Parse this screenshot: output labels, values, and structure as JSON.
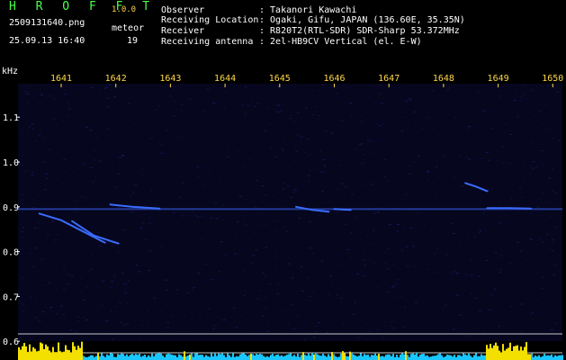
{
  "header": {
    "app_name": "H R O F F T",
    "version": "1.0.0",
    "filename": "2509131640.png",
    "datetime": "25.09.13 16:40",
    "meteor_label": "meteor",
    "meteor_count": "19"
  },
  "station": {
    "rows": [
      {
        "label": "Observer",
        "value": ": Takanori Kawachi"
      },
      {
        "label": "Receiving Location",
        "value": ": Ogaki, Gifu, JAPAN (136.60E, 35.35N)"
      },
      {
        "label": "Receiver",
        "value": ": R820T2(RTL-SDR) SDR-Sharp 53.372MHz"
      },
      {
        "label": "Receiving antenna",
        "value": ": 2el-HB9CV Vertical (el. E-W)"
      }
    ]
  },
  "chart_data": {
    "type": "heatmap",
    "ylabel": "kHz",
    "x_ticks": [
      "1641",
      "1642",
      "1643",
      "1644",
      "1645",
      "1646",
      "1647",
      "1648",
      "1649",
      "1650"
    ],
    "y_ticks": [
      "1.1",
      "1.0",
      "0.9",
      "0.8",
      "0.7",
      "0.6"
    ],
    "ylim": [
      0.58,
      1.2
    ],
    "carrier_khz": 0.895,
    "background_color": "#06061e",
    "noise_color": "#1c1c6a",
    "echo_color": "#3a6cff",
    "echoes": [
      {
        "t": [
          1640.6,
          1641.0,
          1641.4,
          1641.8
        ],
        "f": [
          0.885,
          0.87,
          0.845,
          0.82
        ]
      },
      {
        "t": [
          1641.2,
          1641.6,
          1642.05
        ],
        "f": [
          0.868,
          0.836,
          0.818
        ]
      },
      {
        "t": [
          1641.9,
          1642.3,
          1642.8
        ],
        "f": [
          0.905,
          0.9,
          0.896
        ]
      },
      {
        "t": [
          1645.3,
          1645.6,
          1645.9
        ],
        "f": [
          0.9,
          0.893,
          0.889
        ]
      },
      {
        "t": [
          1646.0,
          1646.3
        ],
        "f": [
          0.895,
          0.893
        ]
      },
      {
        "t": [
          1648.4,
          1648.6,
          1648.8
        ],
        "f": [
          0.953,
          0.945,
          0.935
        ]
      },
      {
        "t": [
          1648.8,
          1649.2,
          1649.6
        ],
        "f": [
          0.897,
          0.897,
          0.896
        ]
      }
    ]
  }
}
